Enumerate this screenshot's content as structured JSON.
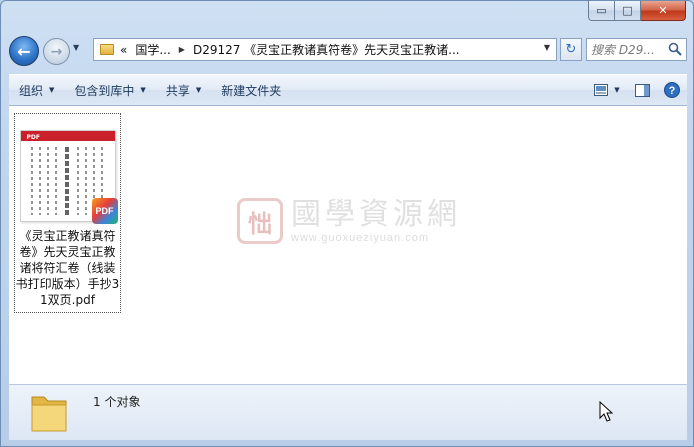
{
  "window": {
    "caption_buttons": {
      "minimize": "▭",
      "maximize": "□",
      "close": "✕"
    }
  },
  "navigation": {
    "back_icon": "back-arrow-icon",
    "forward_icon": "forward-arrow-icon",
    "breadcrumb": {
      "overflow": "«",
      "items": [
        "国学...",
        "D29127 《灵宝正教诸真符卷》先天灵宝正教诸..."
      ]
    },
    "search": {
      "placeholder": "搜索 D29..."
    }
  },
  "toolbar": {
    "organize": "组织",
    "include_in_library": "包含到库中",
    "share": "共享",
    "new_folder": "新建文件夹"
  },
  "file": {
    "name": "《灵宝正教诸真符卷》先天灵宝正教诸将符汇卷（线装书打印版本）手抄31双页.pdf",
    "thumb_title": "PDF",
    "badge": "PDF"
  },
  "watermark": {
    "seal": "㤕",
    "chinese": "國學資源網",
    "url": "www.guoxueziyuan.com"
  },
  "status": {
    "count_text": "1 个对象"
  },
  "colors": {
    "accent": "#1e395b",
    "pdf_red": "#c9202a"
  }
}
